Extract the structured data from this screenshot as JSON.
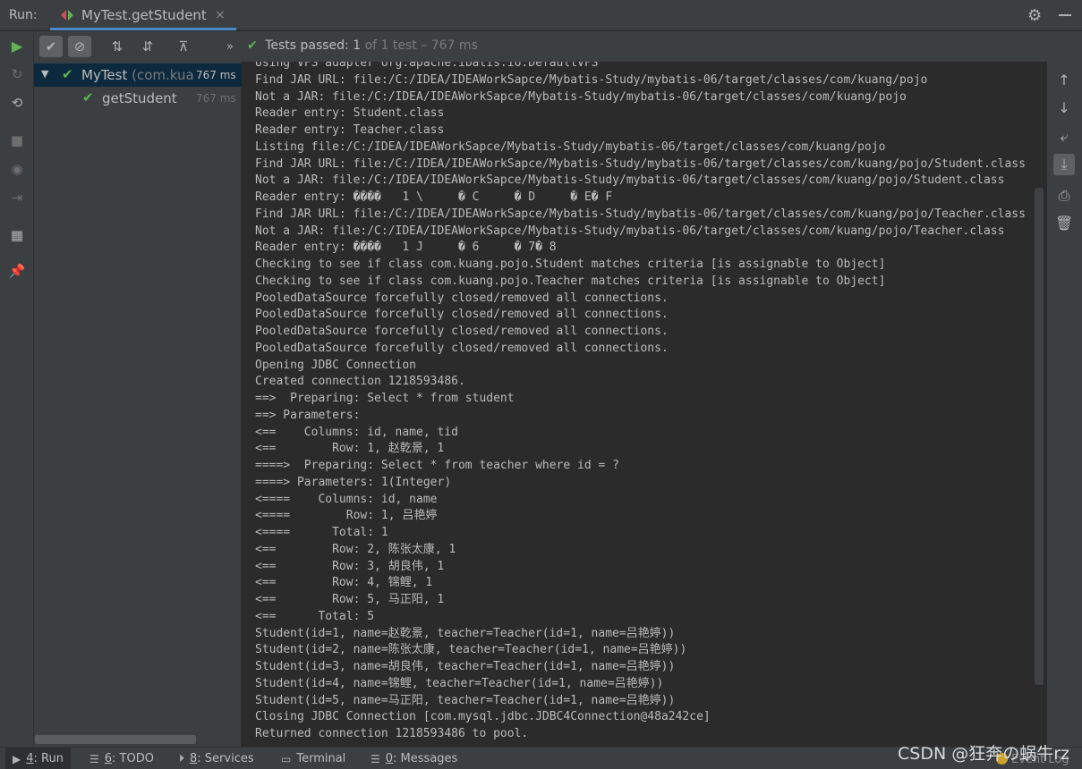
{
  "header": {
    "run_label": "Run:",
    "tab_title": "MyTest.getStudent",
    "tab_close": "×"
  },
  "toolbar": {
    "expand_label": "»"
  },
  "status": {
    "check": "✔",
    "passed_label": "Tests passed:",
    "passed_count": "1",
    "of_text": "of 1 test – 767 ms"
  },
  "tree": {
    "root": {
      "name": "MyTest",
      "package": "(com.kua",
      "time": "767 ms"
    },
    "child": {
      "name": "getStudent",
      "time": "767 ms"
    }
  },
  "console": {
    "lines": [
      "Using VFS adapter org.apache.ibatis.io.DefaultVFS",
      "Find JAR URL: file:/C:/IDEA/IDEAWorkSapce/Mybatis-Study/mybatis-06/target/classes/com/kuang/pojo",
      "Not a JAR: file:/C:/IDEA/IDEAWorkSapce/Mybatis-Study/mybatis-06/target/classes/com/kuang/pojo",
      "Reader entry: Student.class",
      "Reader entry: Teacher.class",
      "Listing file:/C:/IDEA/IDEAWorkSapce/Mybatis-Study/mybatis-06/target/classes/com/kuang/pojo",
      "Find JAR URL: file:/C:/IDEA/IDEAWorkSapce/Mybatis-Study/mybatis-06/target/classes/com/kuang/pojo/Student.class",
      "Not a JAR: file:/C:/IDEA/IDEAWorkSapce/Mybatis-Study/mybatis-06/target/classes/com/kuang/pojo/Student.class",
      "Reader entry: ����   1 \\     � C     � D     � E� F",
      "Find JAR URL: file:/C:/IDEA/IDEAWorkSapce/Mybatis-Study/mybatis-06/target/classes/com/kuang/pojo/Teacher.class",
      "Not a JAR: file:/C:/IDEA/IDEAWorkSapce/Mybatis-Study/mybatis-06/target/classes/com/kuang/pojo/Teacher.class",
      "Reader entry: ����   1 J     � 6     � 7� 8",
      "Checking to see if class com.kuang.pojo.Student matches criteria [is assignable to Object]",
      "Checking to see if class com.kuang.pojo.Teacher matches criteria [is assignable to Object]",
      "PooledDataSource forcefully closed/removed all connections.",
      "PooledDataSource forcefully closed/removed all connections.",
      "PooledDataSource forcefully closed/removed all connections.",
      "PooledDataSource forcefully closed/removed all connections.",
      "Opening JDBC Connection",
      "Created connection 1218593486.",
      "==>  Preparing: Select * from student",
      "==> Parameters: ",
      "<==    Columns: id, name, tid",
      "<==        Row: 1, 赵乾景, 1",
      "====>  Preparing: Select * from teacher where id = ?",
      "====> Parameters: 1(Integer)",
      "<====    Columns: id, name",
      "<====        Row: 1, 吕艳婷",
      "<====      Total: 1",
      "<==        Row: 2, 陈张太康, 1",
      "<==        Row: 3, 胡良伟, 1",
      "<==        Row: 4, 锦鲤, 1",
      "<==        Row: 5, 马正阳, 1",
      "<==      Total: 5",
      "Student(id=1, name=赵乾景, teacher=Teacher(id=1, name=吕艳婷))",
      "Student(id=2, name=陈张太康, teacher=Teacher(id=1, name=吕艳婷))",
      "Student(id=3, name=胡良伟, teacher=Teacher(id=1, name=吕艳婷))",
      "Student(id=4, name=锦鲤, teacher=Teacher(id=1, name=吕艳婷))",
      "Student(id=5, name=马正阳, teacher=Teacher(id=1, name=吕艳婷))",
      "Closing JDBC Connection [com.mysql.jdbc.JDBC4Connection@48a242ce]",
      "Returned connection 1218593486 to pool."
    ]
  },
  "bottom_bar": {
    "run": {
      "key": "4",
      "label": ": Run"
    },
    "todo": {
      "key": "6",
      "label": ": TODO"
    },
    "services": {
      "key": "8",
      "label": ": Services"
    },
    "terminal": {
      "label": "Terminal"
    },
    "messages": {
      "key": "0",
      "label": ": Messages"
    },
    "event_log": "Event Log"
  },
  "watermark": "CSDN @狂奔の蜗牛rz",
  "colors": {
    "pass_green": "#5fb450",
    "selection": "#0d293e",
    "accent_blue": "#4a88c7"
  }
}
